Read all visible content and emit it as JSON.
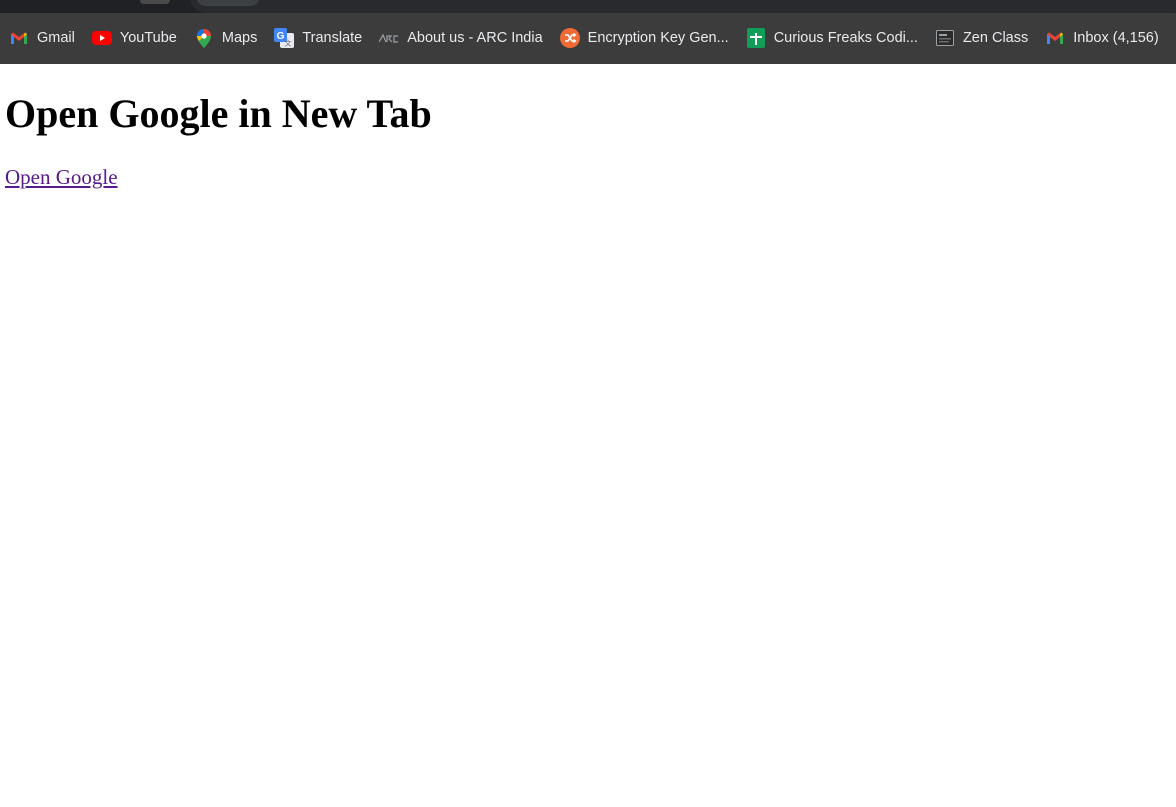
{
  "bookmarks": [
    {
      "label": "Gmail",
      "icon": "gmail-icon"
    },
    {
      "label": "YouTube",
      "icon": "youtube-icon"
    },
    {
      "label": "Maps",
      "icon": "maps-icon"
    },
    {
      "label": "Translate",
      "icon": "translate-icon"
    },
    {
      "label": "About us - ARC India",
      "icon": "arc-logo-icon"
    },
    {
      "label": "Encryption Key Gen...",
      "icon": "shuffle-icon"
    },
    {
      "label": "Curious Freaks Codi...",
      "icon": "sheets-icon"
    },
    {
      "label": "Zen Class",
      "icon": "zen-class-icon"
    },
    {
      "label": "Inbox (4,156)",
      "icon": "gmail-icon"
    }
  ],
  "page": {
    "heading": "Open Google in New Tab",
    "link_text": "Open Google"
  },
  "colors": {
    "toolbar_bg": "#3c3c3c",
    "bookmark_text": "#e8eaed",
    "visited_link": "#551a8b"
  }
}
